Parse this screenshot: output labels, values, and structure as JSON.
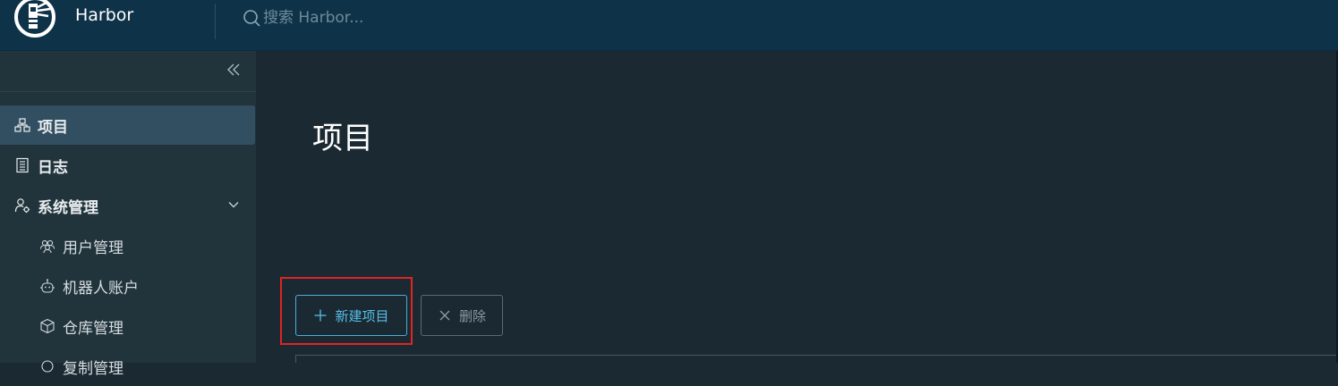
{
  "header": {
    "app_name": "Harbor",
    "search_placeholder": "搜索 Harbor..."
  },
  "sidebar": {
    "items": [
      {
        "label": "项目",
        "icon": "projects-icon",
        "active": true
      },
      {
        "label": "日志",
        "icon": "logs-icon"
      },
      {
        "label": "系统管理",
        "icon": "user-settings-icon",
        "expanded": true
      }
    ],
    "sub_items": [
      {
        "label": "用户管理",
        "icon": "users-icon"
      },
      {
        "label": "机器人账户",
        "icon": "robot-icon"
      },
      {
        "label": "仓库管理",
        "icon": "cube-icon"
      },
      {
        "label": "复制管理",
        "icon": "replication-icon"
      }
    ]
  },
  "main": {
    "title": "项目",
    "new_project_label": "新建项目",
    "delete_label": "删除"
  },
  "colors": {
    "header_bg": "#0e3349",
    "sidebar_bg": "#21333b",
    "main_bg": "#1b2a32",
    "accent": "#57bde8",
    "highlight": "#e02424"
  }
}
